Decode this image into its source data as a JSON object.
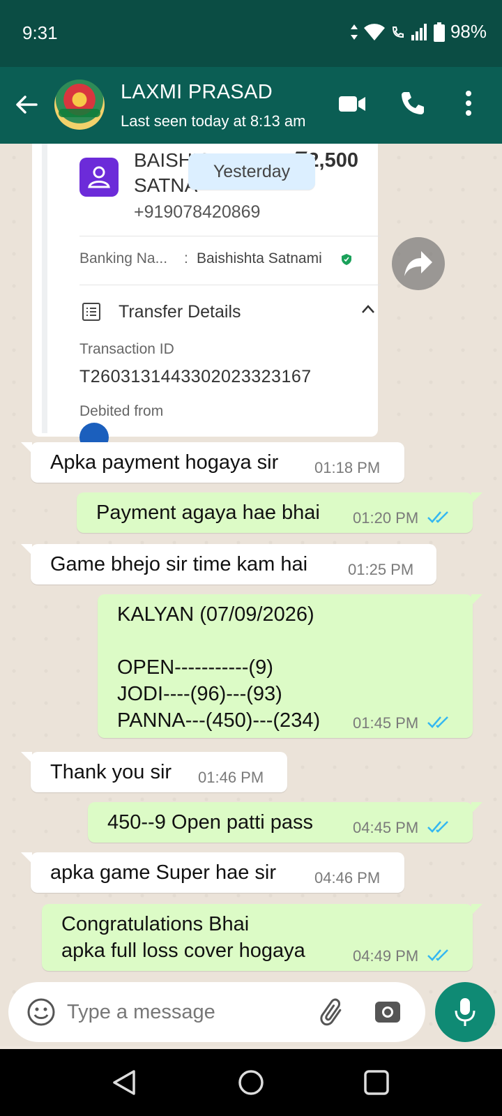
{
  "status_bar": {
    "time": "9:31",
    "battery": "98%"
  },
  "header": {
    "name": "LAXMI PRASAD",
    "last_seen": "Last seen today at 8:13 am"
  },
  "payment_card": {
    "name_line1": "BAISHISHTA",
    "name_line2": "SATNA",
    "amount": "₹2,500",
    "phone": "+919078420869",
    "banking_label": "Banking Na...",
    "banking_colon": ":",
    "banking_name": "Baishishta  Satnami",
    "transfer_title": "Transfer Details",
    "txn_label": "Transaction ID",
    "txn_id": "T2603131443302023323167",
    "debited_label": "Debited from"
  },
  "date_chip": "Yesterday",
  "messages": [
    {
      "dir": "in",
      "text": "Apka payment hogaya sir",
      "time": "01:18 PM"
    },
    {
      "dir": "out",
      "text": "Payment agaya hae bhai",
      "time": "01:20 PM"
    },
    {
      "dir": "in",
      "text": "Game bhejo sir time kam hai",
      "time": "01:25 PM"
    },
    {
      "dir": "out",
      "text": "KALYAN (07/09/2026)\n\nOPEN-----------(9)\nJODI----(96)---(93)\nPANNA---(450)---(234)",
      "time": "01:45 PM"
    },
    {
      "dir": "in",
      "text": "Thank you sir",
      "time": "01:46 PM"
    },
    {
      "dir": "out",
      "text": "450--9 Open patti pass",
      "time": "04:45 PM"
    },
    {
      "dir": "in",
      "text": "apka game Super hae sir",
      "time": "04:46 PM"
    },
    {
      "dir": "out",
      "text": "Congratulations Bhai\napka full loss cover hogaya",
      "time": "04:49 PM"
    }
  ],
  "input": {
    "placeholder": "Type a message"
  },
  "colors": {
    "header": "#0b5e54",
    "status": "#0b4d44",
    "outgoing": "#dcfbc6",
    "tick_blue": "#34b7f1",
    "mic": "#0f8a74"
  },
  "icons": [
    "back-arrow-icon",
    "video-call-icon",
    "phone-icon",
    "more-options-icon",
    "forward-icon",
    "emoji-icon",
    "attach-icon",
    "camera-icon",
    "mic-icon"
  ]
}
